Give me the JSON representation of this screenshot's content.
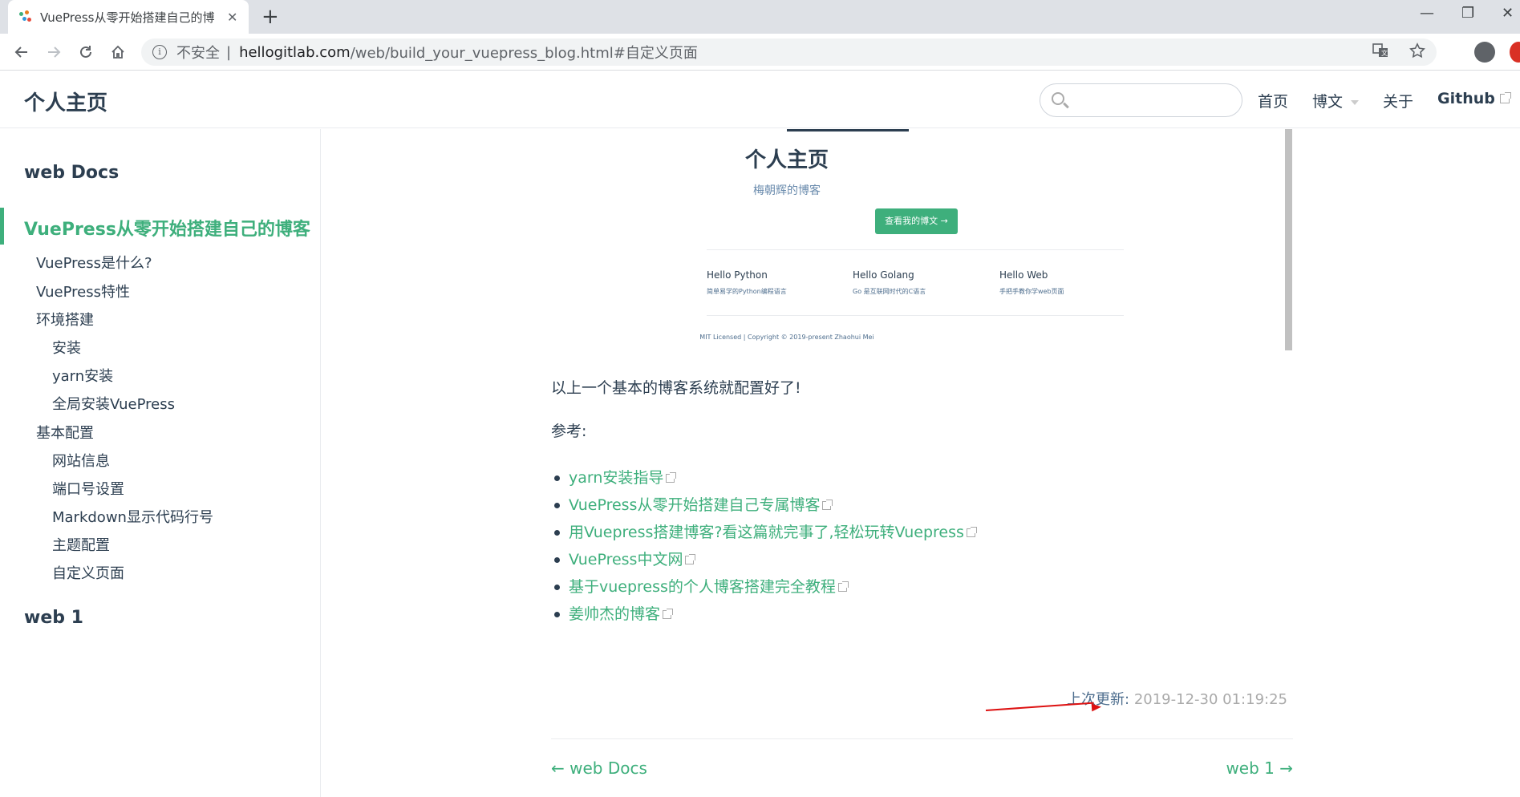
{
  "browser": {
    "tab_title": "VuePress从零开始搭建自己的博",
    "tab_close": "✕",
    "new_tab": "+",
    "security_label": "不安全",
    "separator": "|",
    "url_host": "hellogitlab.com",
    "url_path": "/web/build_your_vuepress_blog.html#自定义页面",
    "window_controls": {
      "minimize": "—",
      "restore": "❐",
      "close": "✕"
    }
  },
  "navbar": {
    "site_name": "个人主页",
    "links": {
      "home": "首页",
      "blog": "博文",
      "about": "关于",
      "github": "Github"
    }
  },
  "sidebar": {
    "group1": "web Docs",
    "active": "VuePress从零开始搭建自己的博客",
    "items": [
      "VuePress是什么?",
      "VuePress特性",
      "环境搭建",
      "安装",
      "yarn安装",
      "全局安装VuePress",
      "基本配置",
      "网站信息",
      "端口号设置",
      "Markdown显示代码行号",
      "主题配置",
      "自定义页面"
    ],
    "group2": "web 1"
  },
  "screenshot": {
    "title": "个人主页",
    "subtitle": "梅朝辉的博客",
    "button": "查看我的博文 →",
    "features": [
      {
        "title": "Hello Python",
        "desc": "简单易学的Python编程语言"
      },
      {
        "title": "Hello Golang",
        "desc": "Go 是互联网时代的C语言"
      },
      {
        "title": "Hello Web",
        "desc": "手把手教你学web页面"
      }
    ],
    "footer": "MIT Licensed | Copyright © 2019-present Zhaohui Mei"
  },
  "content": {
    "conclusion": "以上一个基本的博客系统就配置好了!",
    "refs_label": "参考:",
    "references": [
      "yarn安装指导",
      "VuePress从零开始搭建自己专属博客",
      "用Vuepress搭建博客?看这篇就完事了,轻松玩转Vuepress",
      "VuePress中文网",
      "基于vuepress的个人博客搭建完全教程",
      "姜帅杰的博客"
    ],
    "last_updated_label": "上次更新:",
    "last_updated_value": "2019-12-30 01:19:25",
    "prev": "← web Docs",
    "next": "web 1 →"
  },
  "colors": {
    "accent": "#3eaf7c",
    "text": "#2c3e50",
    "annotation_arrow": "#dd1111"
  }
}
